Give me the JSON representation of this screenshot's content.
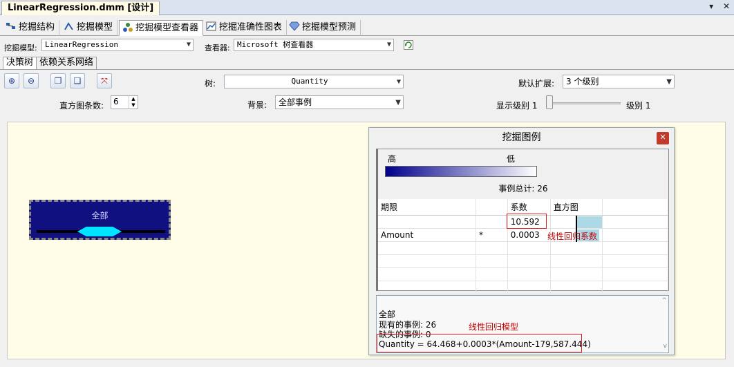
{
  "title_bar": {
    "doc_tab": "LinearRegression.dmm [设计]",
    "ctrl_pin": "▾",
    "ctrl_close": "✕"
  },
  "main_tabs": [
    {
      "label": "挖掘结构",
      "icon": "mining-structure-icon"
    },
    {
      "label": "挖掘模型",
      "icon": "mining-model-icon"
    },
    {
      "label": "挖掘模型查看器",
      "icon": "model-viewer-icon",
      "active": true
    },
    {
      "label": "挖掘准确性图表",
      "icon": "accuracy-chart-icon"
    },
    {
      "label": "挖掘模型预测",
      "icon": "prediction-icon"
    }
  ],
  "model_row": {
    "model_label": "挖掘模型:",
    "model_value": "LinearRegression",
    "viewer_label": "查看器:",
    "viewer_value": "Microsoft 树查看器"
  },
  "sub_tabs": [
    {
      "label": "决策树",
      "active": true
    },
    {
      "label": "依赖关系网络"
    }
  ],
  "toolbar": {
    "hist_label": "直方图条数:",
    "hist_value": "6",
    "tree_label": "树:",
    "tree_value": "Quantity",
    "bg_label": "背景:",
    "bg_value": "全部事例",
    "expand_label": "默认扩展:",
    "expand_value": "3 个级别",
    "show_level_label": "显示级别 1",
    "level_right_label": "级别 1"
  },
  "tree": {
    "node_label": "全部"
  },
  "legend": {
    "title": "挖掘图例",
    "high": "高",
    "low": "低",
    "total_cases": "事例总计: 26",
    "columns": [
      "期限",
      "",
      "系数",
      "直方图"
    ],
    "rows": [
      {
        "term": "",
        "mark": "",
        "coef": "10.592"
      },
      {
        "term": "Amount",
        "mark": "*",
        "coef": "0.0003"
      }
    ],
    "annotation_coef": "线性回归系数",
    "bottom": {
      "node": "全部",
      "existing": "现有的事例: 26",
      "missing": "缺失的事例: 0",
      "formula": "Quantity = 64.468+0.0003*(Amount-179,587.444)",
      "annotation_model": "线性回归模型"
    }
  },
  "colors": {
    "node_fill": "#101080",
    "diamond": "#00e5ff",
    "annotation": "#e02020"
  }
}
